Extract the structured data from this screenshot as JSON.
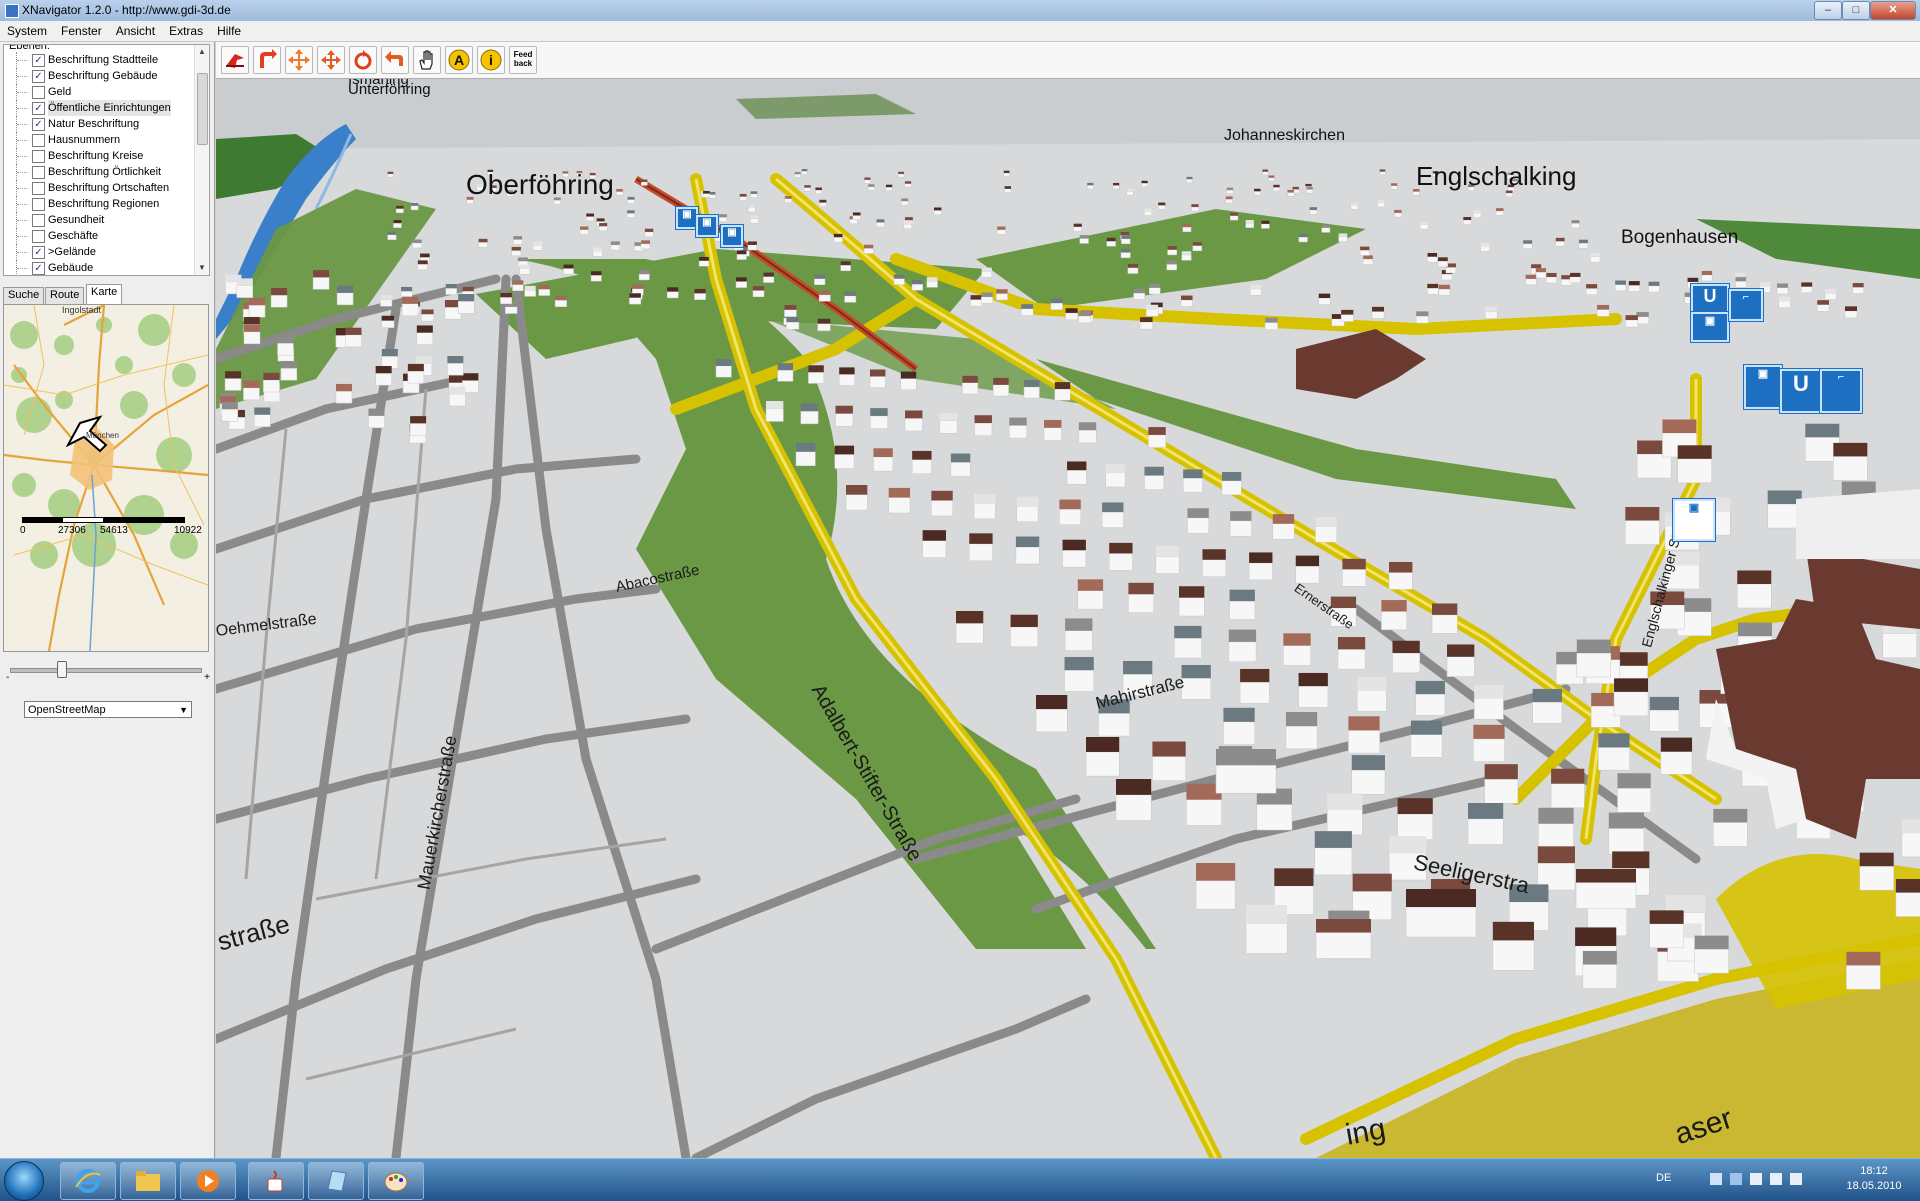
{
  "window": {
    "title": "XNavigator 1.2.0 - http://www.gdi-3d.de",
    "controls": {
      "minimize": "–",
      "maximize": "□",
      "close": "✕"
    }
  },
  "menu": [
    "System",
    "Fenster",
    "Ansicht",
    "Extras",
    "Hilfe"
  ],
  "layers": {
    "title": "Ebenen:",
    "items": [
      {
        "label": "Beschriftung Stadtteile",
        "checked": true
      },
      {
        "label": "Beschriftung Gebäude",
        "checked": true
      },
      {
        "label": "Geld",
        "checked": false
      },
      {
        "label": "Öffentliche Einrichtungen",
        "checked": true,
        "selected": true
      },
      {
        "label": "Natur Beschriftung",
        "checked": true
      },
      {
        "label": "Hausnummern",
        "checked": false
      },
      {
        "label": "Beschriftung Kreise",
        "checked": false
      },
      {
        "label": "Beschriftung Örtlichkeit",
        "checked": false
      },
      {
        "label": "Beschriftung Ortschaften",
        "checked": false
      },
      {
        "label": "Beschriftung Regionen",
        "checked": false
      },
      {
        "label": "Gesundheit",
        "checked": false
      },
      {
        "label": "Geschäfte",
        "checked": false
      },
      {
        "label": ">Gelände",
        "checked": true
      },
      {
        "label": "Gebäude",
        "checked": true
      }
    ]
  },
  "tabs": [
    {
      "label": "Suche",
      "active": false
    },
    {
      "label": "Route",
      "active": false
    },
    {
      "label": "Karte",
      "active": true
    }
  ],
  "minimap": {
    "labels": {
      "north": "Ingolstadt",
      "city": "München"
    },
    "scale": [
      "0",
      "27306",
      "54613",
      "10922"
    ]
  },
  "zoom": {
    "minus": "-",
    "plus": "+",
    "level": 0.26
  },
  "map_source": {
    "selected": "OpenStreetMap"
  },
  "toolbar": [
    {
      "name": "tool-fly-icon"
    },
    {
      "name": "tool-turn-icon"
    },
    {
      "name": "tool-move-icon"
    },
    {
      "name": "tool-pan-icon"
    },
    {
      "name": "tool-rotate-icon"
    },
    {
      "name": "tool-back-icon"
    },
    {
      "name": "tool-hand-icon"
    },
    {
      "name": "tool-label-icon"
    },
    {
      "name": "tool-info-icon"
    },
    {
      "name": "tool-feedback-icon",
      "label": "Feed back"
    }
  ],
  "view3d": {
    "places": [
      {
        "name": "Ismaning"
      },
      {
        "name": "Unterföhring"
      },
      {
        "name": "Johanneskirchen"
      },
      {
        "name": "Oberföhring"
      },
      {
        "name": "Englschalking"
      },
      {
        "name": "Bogenhausen"
      }
    ],
    "streets": [
      {
        "name": "Abacostraße"
      },
      {
        "name": "Oehmelstraße"
      },
      {
        "name": "Mauerkircherstraße"
      },
      {
        "name": "straße"
      },
      {
        "name": "Adalbert-Stifter-Straße"
      },
      {
        "name": "Mahirstraße"
      },
      {
        "name": "Seeligerstra"
      },
      {
        "name": "Englschalkinger Str."
      },
      {
        "name": "Ernerstraße"
      },
      {
        "name": "ing"
      },
      {
        "name": "aser"
      }
    ],
    "poi_labels": {
      "subway": "U"
    }
  },
  "taskbar": {
    "language": "DE",
    "time": "18:12",
    "date": "18.05.2010",
    "apps": [
      "ie-icon",
      "explorer-icon",
      "media-player-icon",
      "java-icon",
      "notepad-icon",
      "paint-icon"
    ]
  },
  "colors": {
    "road_yellow": "#d6c200",
    "park_green": "#6a9845",
    "water": "#3a7fc9",
    "poi_blue": "#1c6fc1",
    "roof": "#5a3328"
  }
}
